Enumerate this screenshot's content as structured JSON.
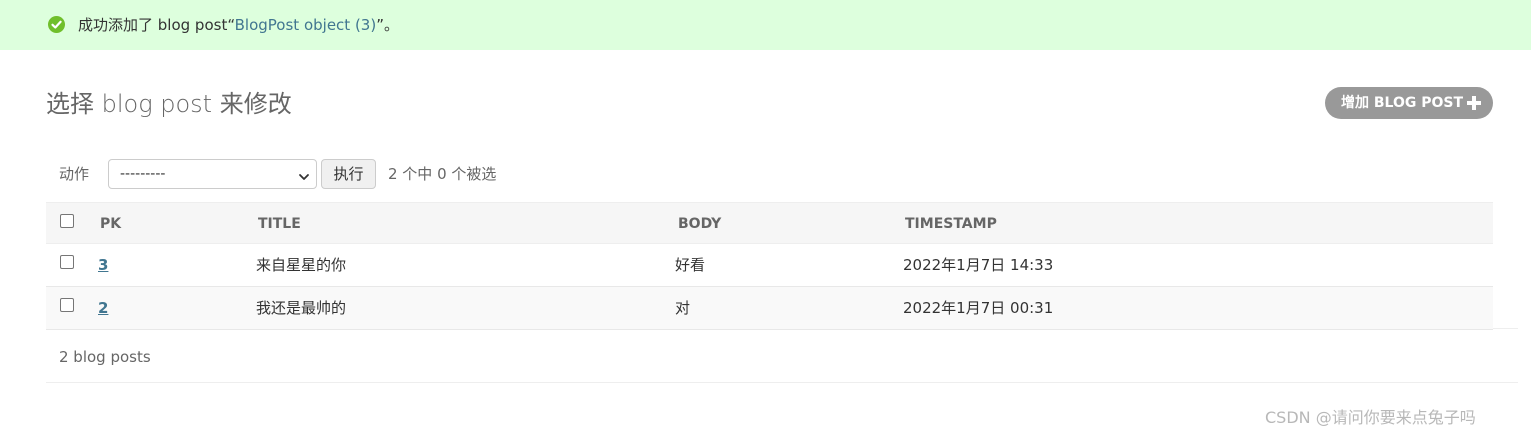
{
  "message": {
    "icon": "check-circle-icon",
    "prefix": "成功添加了 blog post“",
    "link_text": "BlogPost object (3)",
    "suffix": "”。",
    "background": "#ddffdd",
    "icon_color": "#70bf2b"
  },
  "header": {
    "title": "选择 blog post 来修改",
    "add_button_label": "增加 BLOG POST",
    "add_icon": "plus-icon"
  },
  "actions": {
    "label": "动作",
    "select_value": "---------",
    "go_label": "执行",
    "selected_count": "2 个中 0 个被选"
  },
  "table": {
    "columns": [
      "PK",
      "TITLE",
      "BODY",
      "TIMESTAMP"
    ],
    "rows": [
      {
        "pk": "3",
        "title": "来自星星的你",
        "body": "好看",
        "timestamp": "2022年1月7日 14:33"
      },
      {
        "pk": "2",
        "title": "我还是最帅的",
        "body": "对",
        "timestamp": "2022年1月7日 00:31"
      }
    ]
  },
  "paginator": {
    "count_text": "2 blog posts"
  },
  "watermark": "CSDN @请问你要来点兔子吗",
  "colors": {
    "link": "#417690",
    "add_button": "#999999"
  }
}
